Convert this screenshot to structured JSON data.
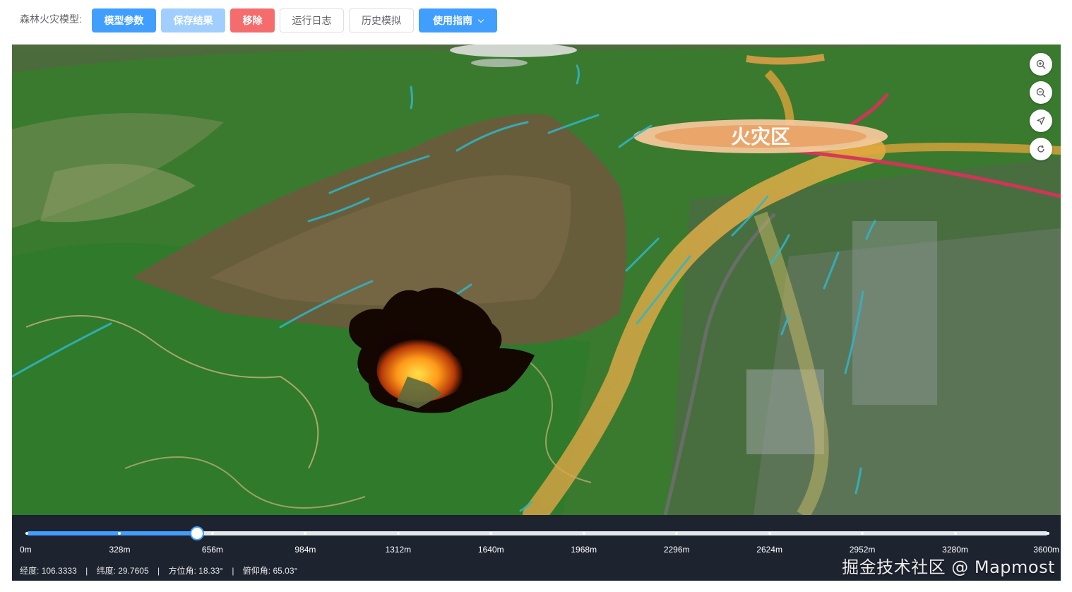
{
  "toolbar": {
    "label": "森林火灾模型:",
    "buttons": {
      "model_params": "模型参数",
      "save_results": "保存结果",
      "remove": "移除",
      "run_log": "运行日志",
      "history_sim": "历史模拟",
      "guide": "使用指南"
    }
  },
  "map": {
    "poi_label": "火灾区"
  },
  "timeline": {
    "progress": 0.1667,
    "ticks": [
      "0m",
      "328m",
      "656m",
      "984m",
      "1312m",
      "1640m",
      "1968m",
      "2296m",
      "2624m",
      "2952m",
      "3280m",
      "3600m"
    ]
  },
  "status": {
    "lon_label": "经度:",
    "lon": "106.3333",
    "lat_label": "纬度:",
    "lat": "29.7605",
    "heading_label": "方位角:",
    "heading": "18.33°",
    "pitch_label": "俯仰角:",
    "pitch": "65.03°",
    "separator": "|"
  },
  "watermark": "掘金技术社区 @ Mapmost",
  "colors": {
    "primary": "#409eff",
    "primary_disabled": "#a0cfff",
    "danger": "#f56c6c",
    "timeline_bg": "#1e2330"
  }
}
